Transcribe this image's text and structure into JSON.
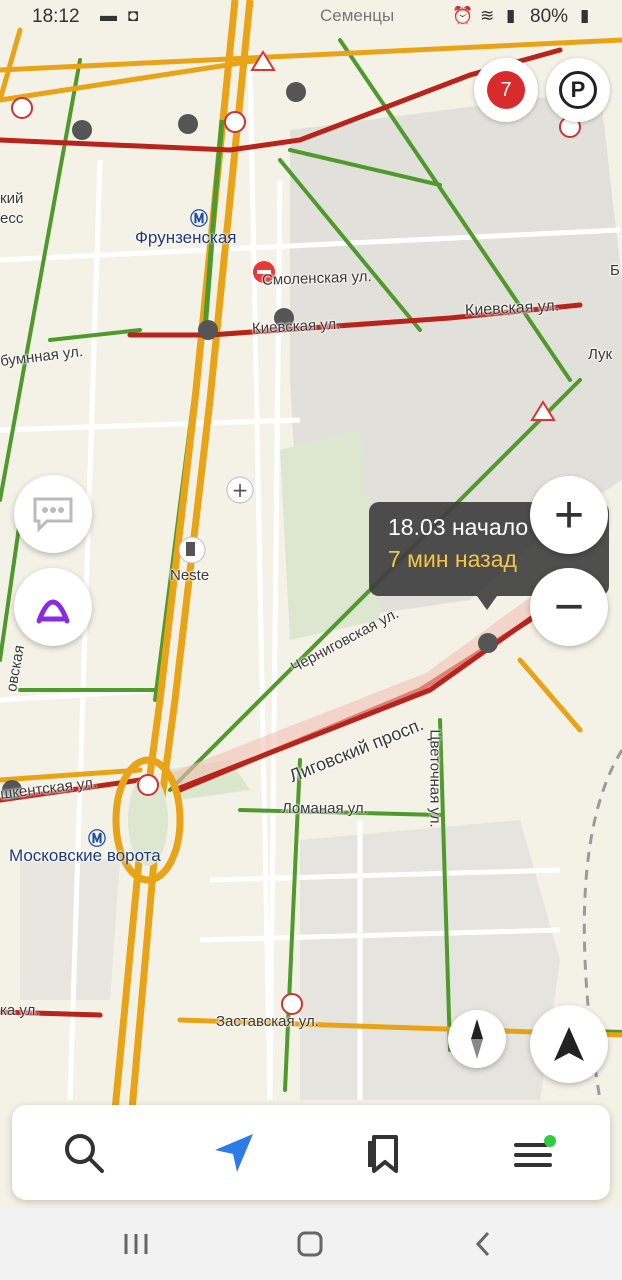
{
  "status_bar": {
    "time": "18:12",
    "battery": "80%",
    "top_place_label": "Семенцы"
  },
  "map": {
    "metro_stations": [
      {
        "name": "Фрунзенская"
      },
      {
        "name": "Московские ворота"
      }
    ],
    "street_labels": {
      "smolenskaya": "Смоленская ул.",
      "kievskaya_1": "Киевская ул.",
      "kievskaya_2": "Киевская ул.",
      "buminnaya": "бумнная ул.",
      "chernigovskaya": "Черниговская ул.",
      "ligovsky": "Лиговский просп.",
      "tsvetochnaya": "Цветочная ул.",
      "lomanaya": "Ломаная ул.",
      "tashkentskaya": "шкентская ул.",
      "zastavskaya": "Заставская ул.",
      "left_ul": "ка ул.",
      "left_cut1": "кий",
      "left_cut2": "есс",
      "left_cut3": "овская",
      "right_luk": "Лук",
      "right_b": "Б"
    },
    "poi": {
      "neste": "Neste"
    }
  },
  "traffic_event": {
    "line1": "18.03 начало",
    "line2": "7 мин назад"
  },
  "controls": {
    "traffic_score": "7",
    "parking_label": "P",
    "zoom_in": "+",
    "zoom_out": "−"
  },
  "colors": {
    "traffic_red": "#b8231b",
    "traffic_yellow": "#e8a317",
    "traffic_green": "#4f9a2c",
    "navigator_blue": "#2e7be6",
    "alice_purple": "#8a2be2"
  }
}
